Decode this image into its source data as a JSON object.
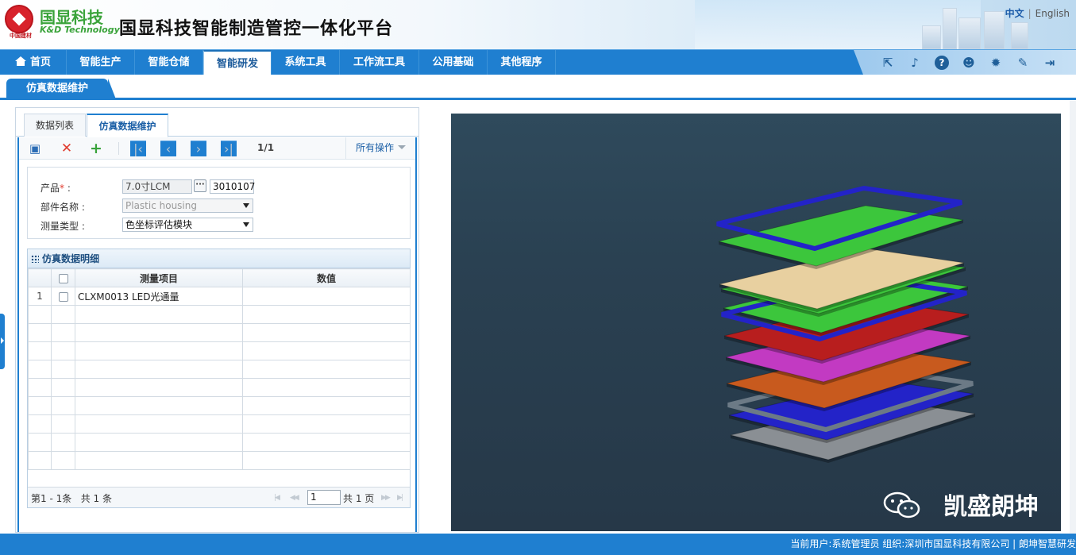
{
  "header": {
    "logo_cn": "国显科技",
    "logo_en": "K&D Technology",
    "logo_sub": "中国建材",
    "app_title": "国显科技智能制造管控一体化平台",
    "lang_active": "中文",
    "lang_other": "English"
  },
  "nav": {
    "items": [
      "首页",
      "智能生产",
      "智能仓储",
      "智能研发",
      "系统工具",
      "工作流工具",
      "公用基础",
      "其他程序"
    ],
    "active_index": 3,
    "toolbar_icons": [
      "export-icon",
      "bell-icon",
      "help-icon",
      "user-icon",
      "gear-icon",
      "wrench-icon",
      "logout-icon"
    ]
  },
  "page_tab": "仿真数据维护",
  "subtabs": [
    "数据列表",
    "仿真数据维护"
  ],
  "opbar": {
    "page_counter": "1/1",
    "all_ops": "所有操作"
  },
  "form": {
    "product_label": "产品",
    "product_name": "7.0寸LCM",
    "product_code": "3010107",
    "part_label": "部件名称",
    "part_value": "Plastic housing",
    "measure_label": "测量类型",
    "measure_value": "色坐标评估模块"
  },
  "grid": {
    "title": "仿真数据明细",
    "columns": [
      "测量项目",
      "数值"
    ],
    "rows": [
      {
        "index": "1",
        "item": "CLXM0013  LED光通量",
        "value": ""
      }
    ],
    "footer_range": "第1 - 1条",
    "footer_total": "共 1 条",
    "page_input": "1",
    "page_total": "共 1 页"
  },
  "viewer": {
    "watermark": "凯盛朗坤",
    "layer_colors": [
      "#2323c8",
      "#3cc63c",
      "#e8d0a0",
      "#3cc63c",
      "#2323c8",
      "#3cc63c",
      "#b81e1e",
      "#c23ac2",
      "#c85a1e",
      "#6c7a86",
      "#2323c8",
      "#8a8f94"
    ]
  },
  "status": {
    "text": "当前用户:系统管理员    组织:深圳市国显科技有限公司 | 朗坤智慧研发"
  }
}
